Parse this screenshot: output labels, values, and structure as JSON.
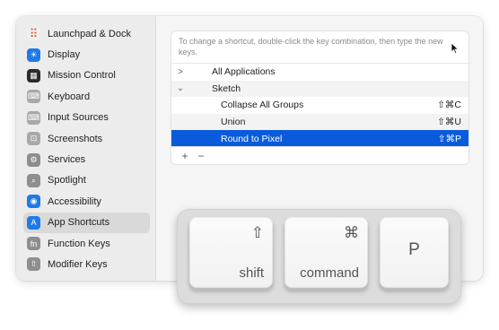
{
  "sidebar": {
    "items": [
      {
        "label": "Launchpad & Dock",
        "icon": "launchpad-icon",
        "color": "#f0f0f0"
      },
      {
        "label": "Display",
        "icon": "display-icon",
        "color": "#1f7ae8"
      },
      {
        "label": "Mission Control",
        "icon": "mission-control-icon",
        "color": "#2b2b2b"
      },
      {
        "label": "Keyboard",
        "icon": "keyboard-icon",
        "color": "#a8a8a8"
      },
      {
        "label": "Input Sources",
        "icon": "input-sources-icon",
        "color": "#a8a8a8"
      },
      {
        "label": "Screenshots",
        "icon": "screenshots-icon",
        "color": "#a8a8a8"
      },
      {
        "label": "Services",
        "icon": "services-icon",
        "color": "#8e8e8e"
      },
      {
        "label": "Spotlight",
        "icon": "spotlight-icon",
        "color": "#8e8e8e"
      },
      {
        "label": "Accessibility",
        "icon": "accessibility-icon",
        "color": "#1f7ae8"
      },
      {
        "label": "App Shortcuts",
        "icon": "app-shortcuts-icon",
        "color": "#1f7ae8"
      },
      {
        "label": "Function Keys",
        "icon": "function-keys-icon",
        "color": "#8e8e8e"
      },
      {
        "label": "Modifier Keys",
        "icon": "modifier-keys-icon",
        "color": "#8e8e8e"
      }
    ],
    "active_index": 9
  },
  "panel": {
    "hint": "To change a shortcut, double-click the key combination, then type the new keys.",
    "rows": [
      {
        "label": "All Applications",
        "chevron": ">",
        "key": "",
        "indent": 1
      },
      {
        "label": "Sketch",
        "chevron": "⌄",
        "key": "",
        "indent": 1
      },
      {
        "label": "Collapse All Groups",
        "chevron": "",
        "key": "⇧⌘C",
        "indent": 2
      },
      {
        "label": "Union",
        "chevron": "",
        "key": "⇧⌘U",
        "indent": 2
      },
      {
        "label": "Round to Pixel",
        "chevron": "",
        "key": "⇧⌘P",
        "indent": 2,
        "selected": true
      }
    ],
    "add_label": "+",
    "remove_label": "−"
  },
  "keys": {
    "shift": {
      "glyph": "⇧",
      "label": "shift"
    },
    "command": {
      "glyph": "⌘",
      "label": "command"
    },
    "p": {
      "label": "P"
    }
  },
  "colors": {
    "selection": "#0a5bdc"
  }
}
